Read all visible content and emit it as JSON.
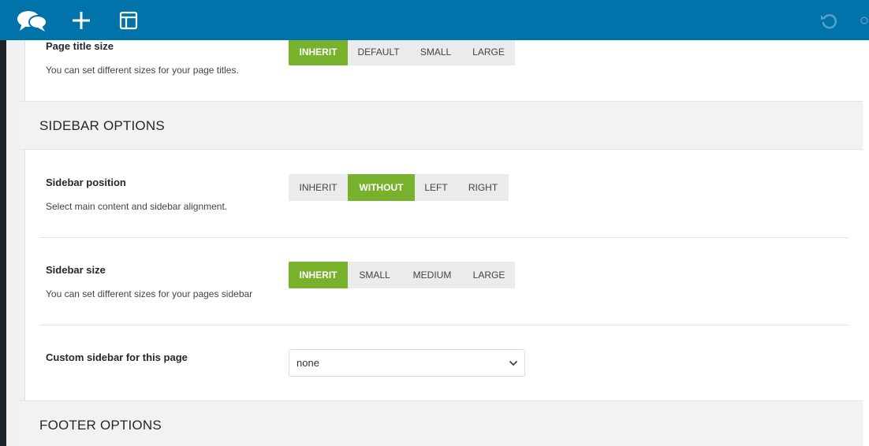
{
  "toolbar": {
    "logo_icon": "speech-bubbles-icon",
    "add_icon": "plus-icon",
    "layout_icon": "layout-icon",
    "undo_icon": "undo-icon",
    "accent_color": "#0073aa"
  },
  "page_title_size": {
    "label": "Page title size",
    "description": "You can set different sizes for your page titles.",
    "options": [
      "INHERIT",
      "DEFAULT",
      "SMALL",
      "LARGE"
    ],
    "selected": "INHERIT"
  },
  "sidebar_section": {
    "title": "SIDEBAR OPTIONS"
  },
  "sidebar_position": {
    "label": "Sidebar position",
    "description": "Select main content and sidebar alignment.",
    "options": [
      "INHERIT",
      "WITHOUT",
      "LEFT",
      "RIGHT"
    ],
    "selected": "WITHOUT"
  },
  "sidebar_size": {
    "label": "Sidebar size",
    "description": "You can set different sizes for your pages sidebar",
    "options": [
      "INHERIT",
      "SMALL",
      "MEDIUM",
      "LARGE"
    ],
    "selected": "INHERIT"
  },
  "custom_sidebar": {
    "label": "Custom sidebar for this page",
    "value": "none"
  },
  "footer_section": {
    "title": "FOOTER OPTIONS"
  },
  "colors": {
    "active_button": "#78b12b",
    "inactive_button": "#ebebeb"
  }
}
